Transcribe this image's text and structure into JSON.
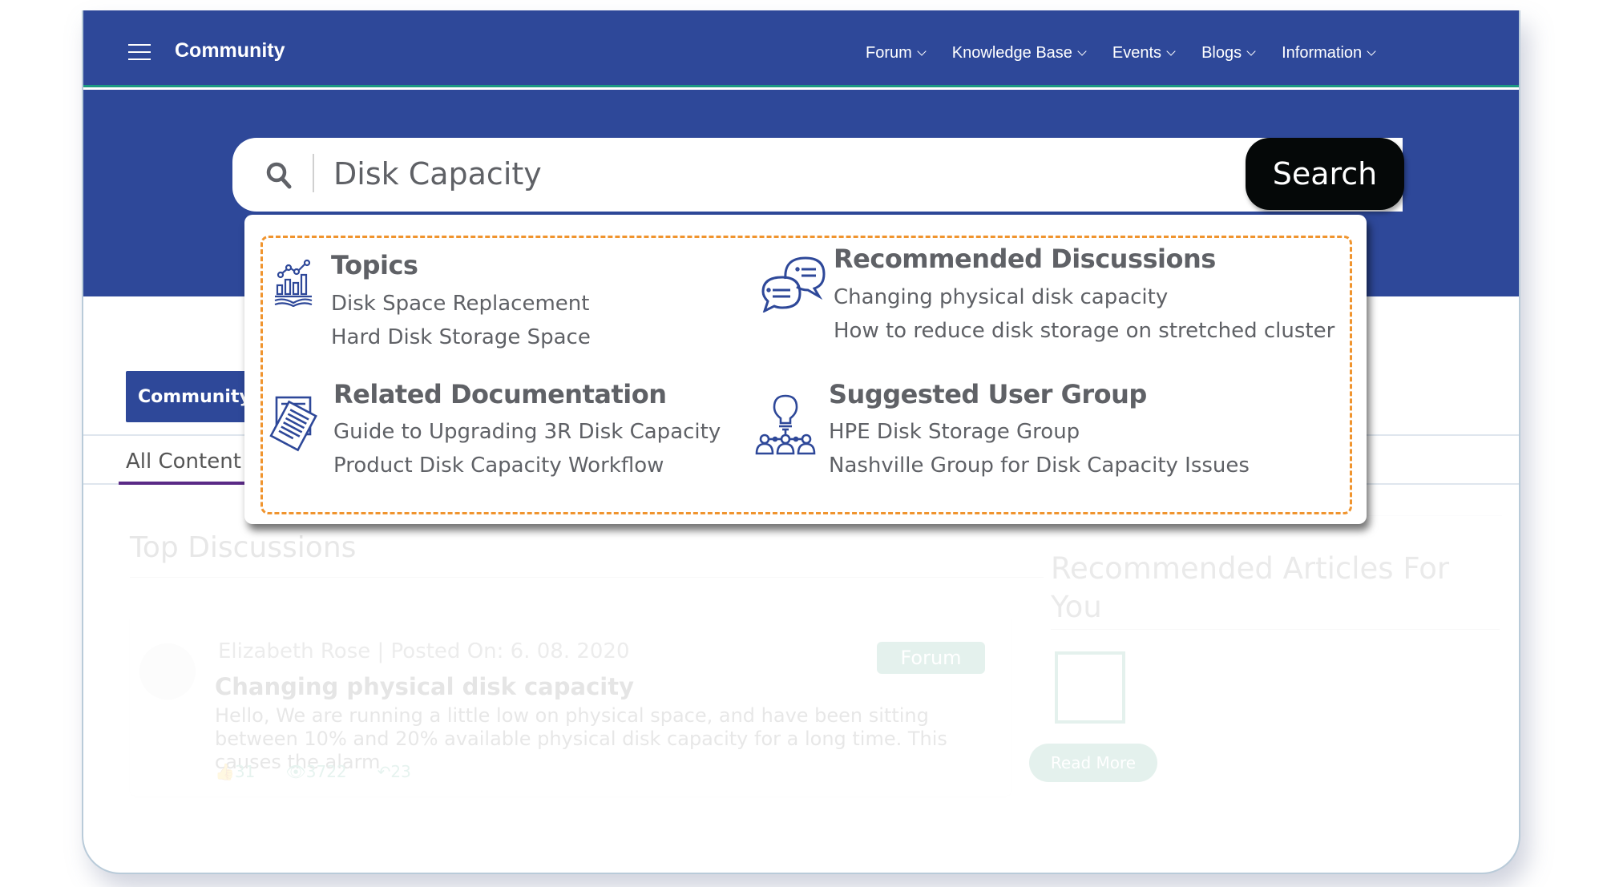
{
  "nav": {
    "brand": "Community",
    "links": [
      {
        "label": "Forum"
      },
      {
        "label": "Knowledge Base"
      },
      {
        "label": "Events"
      },
      {
        "label": "Blogs"
      },
      {
        "label": "Information"
      }
    ]
  },
  "search": {
    "value": "Disk Capacity",
    "button_label": "Search"
  },
  "suggestions": {
    "topics": {
      "title": "Topics",
      "icon": "chart-book-icon",
      "items": [
        "Disk Space Replacement",
        "Hard Disk Storage Space"
      ]
    },
    "recommended_discussions": {
      "title": "Recommended Discussions",
      "icon": "chat-bubbles-icon",
      "items": [
        "Changing physical disk capacity",
        "How to reduce disk storage on stretched cluster"
      ]
    },
    "related_documentation": {
      "title": "Related Documentation",
      "icon": "documents-icon",
      "items": [
        "Guide to Upgrading 3R Disk Capacity",
        "Product Disk Capacity Workflow"
      ]
    },
    "suggested_user_group": {
      "title": "Suggested User Group",
      "icon": "lightbulb-group-icon",
      "items": [
        "HPE Disk Storage Group",
        "Nashville Group for Disk Capacity Issues"
      ]
    }
  },
  "background": {
    "community_button": "Community",
    "tab_all_content": "All Content",
    "top_discussions_title": "Top Discussions",
    "post": {
      "meta": "Elizabeth Rose | Posted On: 6. 08. 2020",
      "title": "Changing physical disk capacity",
      "body": "Hello, We are running a little low on physical space, and have been sitting between 10% and 20% available physical disk capacity for a long time. This causes the alarm",
      "likes": "31",
      "views": "3722",
      "replies": "23",
      "badge": "Forum"
    },
    "recommended_articles_title": "Recommended Articles For You",
    "read_more": "Read More"
  },
  "colors": {
    "brand_blue": "#2e4899",
    "accent_green": "#1c9a82",
    "dashed_orange": "#f0942e",
    "icon_blue": "#2e4899",
    "text_gray": "#5f6166"
  }
}
